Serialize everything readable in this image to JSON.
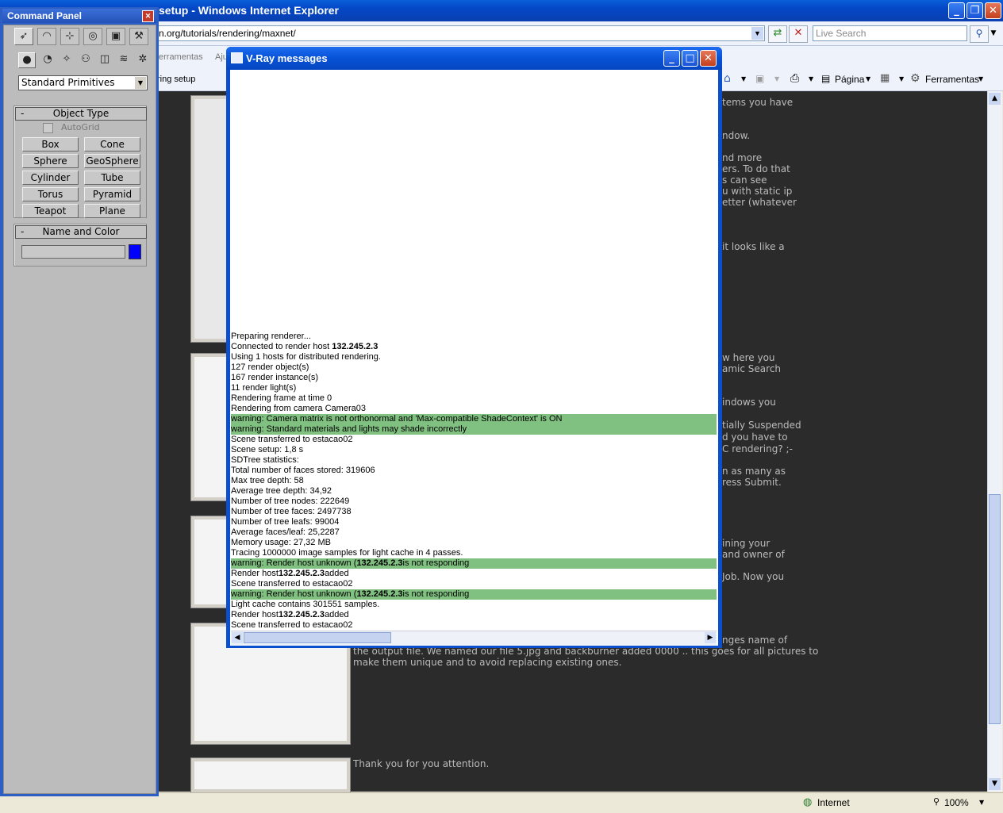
{
  "ie": {
    "title": "setup - Windows Internet Explorer",
    "address": "n.org/tutorials/rendering/maxnet/",
    "search_placeholder": "Live Search",
    "tab_partial": "erramentas",
    "tab_partial2": "Aju",
    "tab_label": "ring setup",
    "cmd_pagina": "Página",
    "cmd_ferramentas": "Ferramentas",
    "status_zone": "Internet",
    "status_zoom": "100%"
  },
  "page_text": {
    "lines_right": [
      "tems you have",
      "ndow.",
      "nd more",
      "ers. To do that",
      "s can see",
      "u with static ip",
      "etter (whatever",
      "it looks like a",
      "w here you",
      "amic Search",
      "indows you",
      "tially Suspended",
      "d you have to",
      "C rendering? ;-",
      "n as many as",
      "ress Submit.",
      "ining your",
      " and owner of",
      "Job. Now you",
      "nges name of"
    ],
    "bottom_line1": "the output file. We named our file 5.jpg and backburner added 0000 .. this goes for all pictures to",
    "bottom_line2": "make them unique and to avoid replacing existing ones.",
    "thanks": "Thank you for you attention."
  },
  "command_panel": {
    "title": "Command Panel",
    "dropdown": "Standard Primitives",
    "object_type": "Object Type",
    "autogrid": "AutoGrid",
    "primitives": [
      "Box",
      "Cone",
      "Sphere",
      "GeoSphere",
      "Cylinder",
      "Tube",
      "Torus",
      "Pyramid",
      "Teapot",
      "Plane"
    ],
    "name_and_color": "Name and Color",
    "color": "#0000ff"
  },
  "vray": {
    "title": "V-Ray messages",
    "lines": [
      {
        "text": "Preparing renderer...",
        "warn": false
      },
      {
        "text": "Connected to render host ",
        "bold": "132.245.2.3",
        "after": "",
        "warn": false
      },
      {
        "text": "Using 1 hosts for distributed rendering.",
        "warn": false
      },
      {
        "text": "127 render object(s)",
        "warn": false
      },
      {
        "text": "167 render instance(s)",
        "warn": false
      },
      {
        "text": "11 render light(s)",
        "warn": false
      },
      {
        "text": "Rendering frame at time 0",
        "warn": false
      },
      {
        "text": "Rendering from camera Camera03",
        "warn": false
      },
      {
        "text": "warning: Camera matrix is not orthonormal and 'Max-compatible ShadeContext' is ON",
        "warn": true
      },
      {
        "text": "warning: Standard materials and lights may shade incorrectly",
        "warn": true
      },
      {
        "text": "Scene transferred to estacao02",
        "warn": false
      },
      {
        "text": "Scene setup: 1,8 s",
        "warn": false
      },
      {
        "text": "SDTree statistics:",
        "warn": false
      },
      {
        "text": "Total number of faces stored: 319606",
        "warn": false
      },
      {
        "text": "Max tree depth: 58",
        "warn": false
      },
      {
        "text": "Average tree depth: 34,92",
        "warn": false
      },
      {
        "text": "Number of tree nodes: 222649",
        "warn": false
      },
      {
        "text": "Number of tree faces: 2497738",
        "warn": false
      },
      {
        "text": "Number of tree leafs: 99004",
        "warn": false
      },
      {
        "text": "Average faces/leaf: 25,2287",
        "warn": false
      },
      {
        "text": "Memory usage: 27,32 MB",
        "warn": false
      },
      {
        "text": "Tracing 1000000 image samples for light cache in 4 passes.",
        "warn": false
      },
      {
        "text": "warning: Render host unknown (",
        "bold": "132.245.2.3",
        "after": "is not responding",
        "warn": true
      },
      {
        "text": "Render host",
        "bold": "132.245.2.3",
        "after": "added",
        "warn": false
      },
      {
        "text": "Scene transferred to estacao02",
        "warn": false
      },
      {
        "text": "warning: Render host unknown (",
        "bold": "132.245.2.3",
        "after": "is not responding",
        "warn": true
      },
      {
        "text": "Light cache contains 301551 samples.",
        "warn": false
      },
      {
        "text": "Render host",
        "bold": "132.245.2.3",
        "after": "added",
        "warn": false
      },
      {
        "text": "Scene transferred to estacao02",
        "warn": false
      }
    ]
  }
}
